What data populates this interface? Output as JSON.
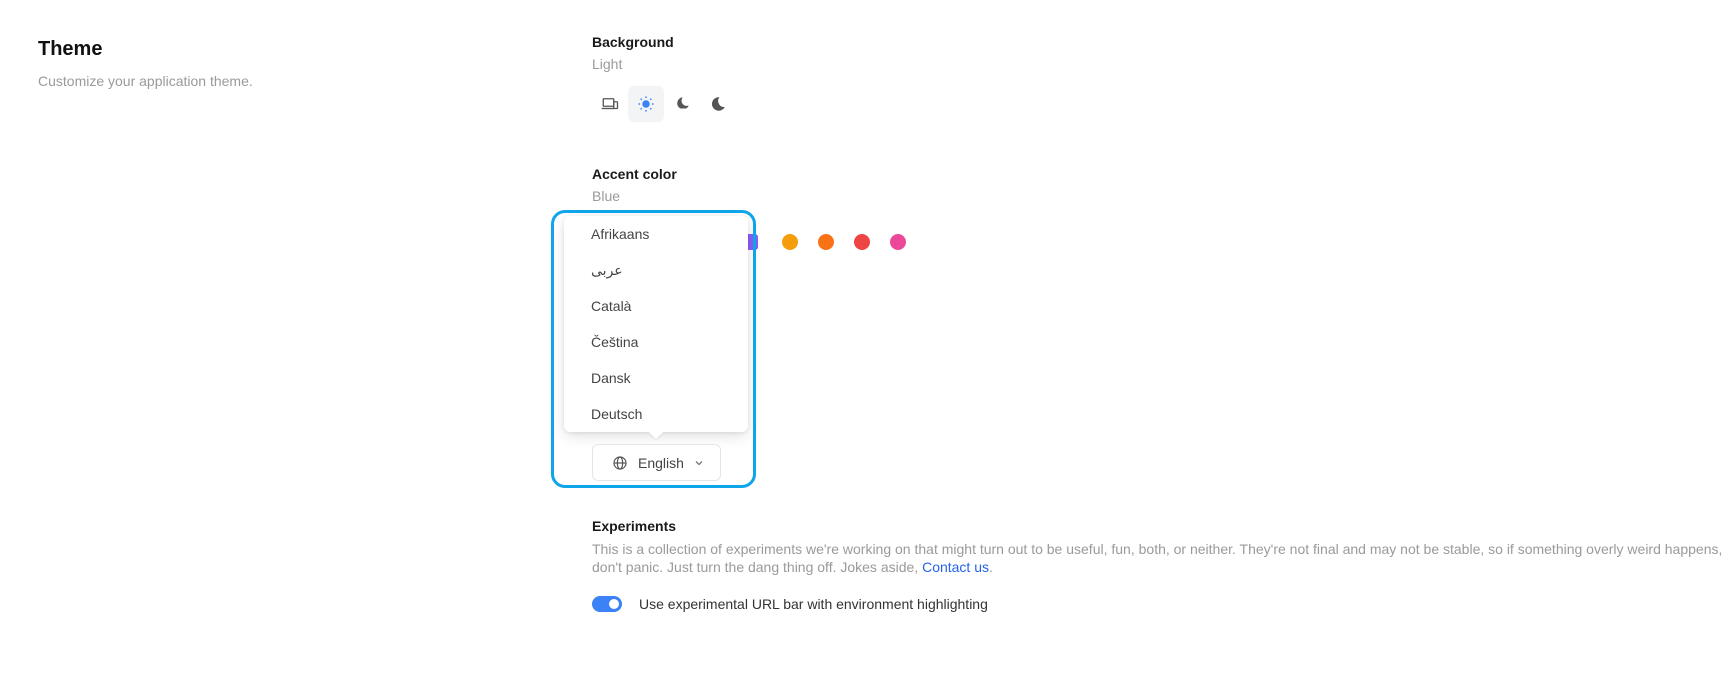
{
  "theme": {
    "title": "Theme",
    "subtitle": "Customize your application theme."
  },
  "background": {
    "label": "Background",
    "value": "Light",
    "options": [
      {
        "icon": "devices-icon",
        "active": false
      },
      {
        "icon": "sun-icon",
        "active": true
      },
      {
        "icon": "moon-stars-icon",
        "active": false
      },
      {
        "icon": "moon-icon",
        "active": false
      }
    ]
  },
  "accent": {
    "label": "Accent color",
    "value": "Blue",
    "swatches": [
      "#8b5cf6",
      "#f59e0b",
      "#f97316",
      "#ef4444",
      "#ec4899"
    ]
  },
  "language": {
    "options": [
      "Afrikaans",
      "عربى",
      "Català",
      "Čeština",
      "Dansk",
      "Deutsch"
    ],
    "selected": "English"
  },
  "experiments": {
    "label": "Experiments",
    "description": "This is a collection of experiments we're working on that might turn out to be useful, fun, both, or neither. They're not final and may not be stable, so if something overly weird happens, don't panic. Just turn the dang thing off. Jokes aside, ",
    "contact_link": "Contact us",
    "period": ".",
    "toggle_label": "Use experimental URL bar with environment highlighting",
    "toggle_on": true
  },
  "colors": {
    "accent_blue": "#3b82f6",
    "highlight": "#0ea5e9"
  }
}
